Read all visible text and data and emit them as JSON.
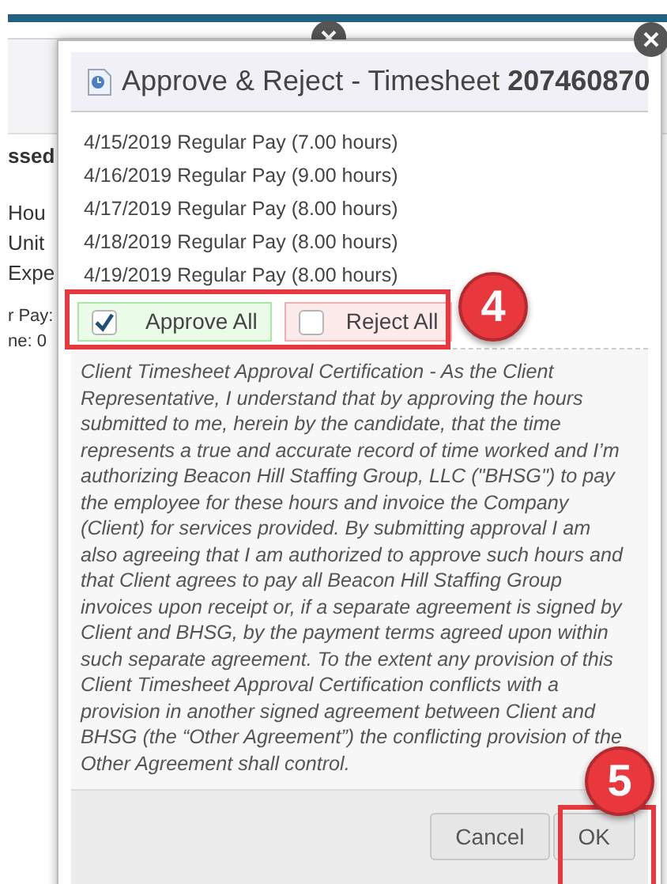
{
  "background_page": {
    "heading": "ssed",
    "fragments": [
      "Hou",
      "Unit",
      "Expe"
    ],
    "details": [
      "r Pay:",
      "ne: 0"
    ]
  },
  "dialog": {
    "title": "Approve & Reject - Timesheet **207460870**",
    "entries": [
      "4/15/2019 Regular Pay (7.00 hours)",
      "4/16/2019 Regular Pay (9.00 hours)",
      "4/17/2019 Regular Pay (8.00 hours)",
      "4/18/2019 Regular Pay (8.00 hours)",
      "4/19/2019 Regular Pay (8.00 hours)"
    ],
    "approve_all": {
      "label": "Approve All",
      "checked": true
    },
    "reject_all": {
      "label": "Reject All",
      "checked": false
    },
    "certification": "Client Timesheet Approval Certification - As the Client Representative, I understand that by approving the hours submitted to me, herein by the candidate, that the time represents a true and accurate record of time worked and I’m authorizing Beacon Hill Staffing Group, LLC (\"BHSG\") to pay the employee for these hours and invoice the Company (Client) for services provided. By submitting approval I am also agreeing that I am authorized to approve such hours and that Client agrees to pay all Beacon Hill Staffing Group invoices upon receipt or, if a separate agreement is signed by Client and BHSG, by the payment terms agreed upon within such separate agreement. To the extent any provision of this Client Timesheet Approval Certification conflicts with a provision in another signed agreement between Client and BHSG (the “Other Agreement”) the conflicting provision of the Other Agreement shall control.",
    "buttons": [
      {
        "label": "Cancel"
      },
      {
        "label": "OK"
      }
    ]
  },
  "callouts": [
    {
      "label": "4"
    },
    {
      "label": "5"
    }
  ]
}
